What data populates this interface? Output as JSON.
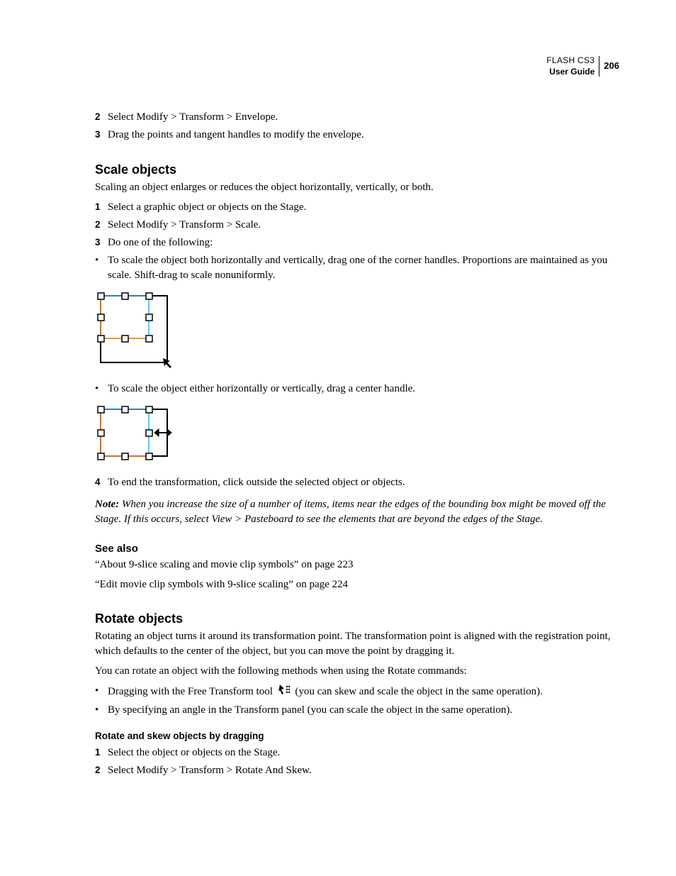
{
  "header": {
    "title": "FLASH CS3",
    "subtitle": "User Guide",
    "page": "206"
  },
  "prelist": {
    "items": [
      {
        "n": "2",
        "t": "Select Modify > Transform > Envelope."
      },
      {
        "n": "3",
        "t": "Drag the points and tangent handles to modify the envelope."
      }
    ]
  },
  "scale": {
    "heading": "Scale objects",
    "intro": "Scaling an object enlarges or reduces the object horizontally, vertically, or both.",
    "steps": [
      {
        "n": "1",
        "t": "Select a graphic object or objects on the Stage."
      },
      {
        "n": "2",
        "t": "Select Modify > Transform > Scale."
      },
      {
        "n": "3",
        "t": "Do one of the following:"
      }
    ],
    "bullets1": [
      "To scale the object both horizontally and vertically, drag one of the corner handles. Proportions are maintained as you scale. Shift-drag to scale nonuniformly."
    ],
    "bullets2": [
      "To scale the object either horizontally or vertically, drag a center handle."
    ],
    "step4": {
      "n": "4",
      "t": "To end the transformation, click outside the selected object or objects."
    },
    "note_label": "Note:",
    "note_text": " When you increase the size of a number of items, items near the edges of the bounding box might be moved off the Stage. If this occurs, select View > Pasteboard to see the elements that are beyond the edges of the Stage."
  },
  "seealso": {
    "heading": "See also",
    "items": [
      "“About 9-slice scaling and movie clip symbols” on page 223",
      "“Edit movie clip symbols with 9-slice scaling” on page 224"
    ]
  },
  "rotate": {
    "heading": "Rotate objects",
    "p1": "Rotating an object turns it around its transformation point. The transformation point is aligned with the registration point, which defaults to the center of the object, but you can move the point by dragging it.",
    "p2": "You can rotate an object with the following methods when using the Rotate commands:",
    "bullet1_pre": "Dragging with the Free Transform tool",
    "bullet1_post": "(you can skew and scale the object in the same operation).",
    "bullet2": "By specifying an angle in the Transform panel (you can scale the object in the same operation).",
    "sub": "Rotate and skew objects by dragging",
    "substeps": [
      {
        "n": "1",
        "t": "Select the object or objects on the Stage."
      },
      {
        "n": "2",
        "t": "Select Modify > Transform > Rotate And Skew."
      }
    ]
  }
}
